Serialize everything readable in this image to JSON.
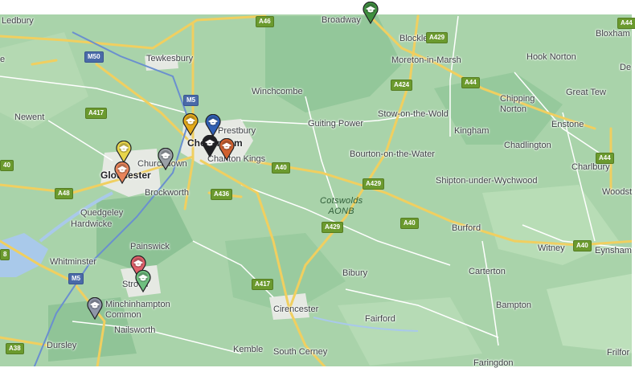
{
  "map": {
    "colors": {
      "land": "#a9d3aa",
      "land_dark": "#8fc496",
      "land_light": "#c4e2c2",
      "urban": "#e8ebe6",
      "water": "#a9c9ea",
      "road_major": "#f3d36b",
      "road_outline": "#d8b54a",
      "road_minor": "#ffffff",
      "top_bar": "#ffffff"
    },
    "places": [
      {
        "name": "Ledbury",
        "size": "normal"
      },
      {
        "name": "Broadway",
        "size": "normal"
      },
      {
        "name": "Blockley",
        "size": "normal"
      },
      {
        "name": "Bloxham",
        "size": "normal"
      },
      {
        "name": "Tewkesbury",
        "size": "normal"
      },
      {
        "name": "Moreton-in-Marsh",
        "size": "normal"
      },
      {
        "name": "Hook Norton",
        "size": "normal"
      },
      {
        "name": "De",
        "size": "normal"
      },
      {
        "name": "e",
        "size": "normal"
      },
      {
        "name": "Winchcombe",
        "size": "normal"
      },
      {
        "name": "Great Tew",
        "size": "normal"
      },
      {
        "name": "Newent",
        "size": "normal"
      },
      {
        "name": "Chipping\nNorton",
        "size": "normal"
      },
      {
        "name": "Prestbury",
        "size": "normal"
      },
      {
        "name": "Guiting Power",
        "size": "normal"
      },
      {
        "name": "Stow-on-the-Wold",
        "size": "normal"
      },
      {
        "name": "Enstone",
        "size": "normal"
      },
      {
        "name": "Kingham",
        "size": "normal"
      },
      {
        "name": "Cheltenham",
        "size": "big"
      },
      {
        "name": "Chadlington",
        "size": "normal"
      },
      {
        "name": "Charlton Kings",
        "size": "normal"
      },
      {
        "name": "Churchdown",
        "size": "normal"
      },
      {
        "name": "Bourton-on-the-Water",
        "size": "normal"
      },
      {
        "name": "Charlbury",
        "size": "normal"
      },
      {
        "name": "Gloucester",
        "size": "big"
      },
      {
        "name": "Shipton-under-Wychwood",
        "size": "normal"
      },
      {
        "name": "Woodst",
        "size": "normal"
      },
      {
        "name": "Brockworth",
        "size": "normal"
      },
      {
        "name": "Quedgeley",
        "size": "normal"
      },
      {
        "name": "Hardwicke",
        "size": "normal"
      },
      {
        "name": "Burford",
        "size": "normal"
      },
      {
        "name": "Painswick",
        "size": "normal"
      },
      {
        "name": "Witney",
        "size": "normal"
      },
      {
        "name": "Eynsham",
        "size": "normal"
      },
      {
        "name": "Whitminster",
        "size": "normal"
      },
      {
        "name": "Carterton",
        "size": "normal"
      },
      {
        "name": "Bibury",
        "size": "normal"
      },
      {
        "name": "Stroud",
        "size": "normal"
      },
      {
        "name": "Minchinhampton\nCommon",
        "size": "normal"
      },
      {
        "name": "Bampton",
        "size": "normal"
      },
      {
        "name": "Cirencester",
        "size": "normal"
      },
      {
        "name": "Fairford",
        "size": "normal"
      },
      {
        "name": "Nailsworth",
        "size": "normal"
      },
      {
        "name": "Kemble",
        "size": "normal"
      },
      {
        "name": "South Cerney",
        "size": "normal"
      },
      {
        "name": "Dursley",
        "size": "normal"
      },
      {
        "name": "Faringdon",
        "size": "normal"
      },
      {
        "name": "Frilfor",
        "size": "normal"
      }
    ],
    "aonb_label": "Cotswolds\nAONB",
    "road_shields": [
      {
        "label": "A46",
        "kind": "a"
      },
      {
        "label": "A429",
        "kind": "a"
      },
      {
        "label": "A44",
        "kind": "a"
      },
      {
        "label": "M50",
        "kind": "m"
      },
      {
        "label": "A424",
        "kind": "a"
      },
      {
        "label": "A44",
        "kind": "a"
      },
      {
        "label": "M5",
        "kind": "m"
      },
      {
        "label": "A417",
        "kind": "a"
      },
      {
        "label": "A40",
        "kind": "a"
      },
      {
        "label": "A44",
        "kind": "a"
      },
      {
        "label": "40",
        "kind": "a"
      },
      {
        "label": "A429",
        "kind": "a"
      },
      {
        "label": "A48",
        "kind": "a"
      },
      {
        "label": "A436",
        "kind": "a"
      },
      {
        "label": "A40",
        "kind": "a"
      },
      {
        "label": "A429",
        "kind": "a"
      },
      {
        "label": "A40",
        "kind": "a"
      },
      {
        "label": "8",
        "kind": "a"
      },
      {
        "label": "M5",
        "kind": "m"
      },
      {
        "label": "A417",
        "kind": "a"
      },
      {
        "label": "A38",
        "kind": "a"
      }
    ],
    "pins": [
      {
        "name": "broadway-pin",
        "color": "#3f8f3f"
      },
      {
        "name": "cheltenham-gold-pin",
        "color": "#e3a91a"
      },
      {
        "name": "prestbury-blue-pin",
        "color": "#2f5fb5"
      },
      {
        "name": "cheltenham-black-pin",
        "color": "#202124"
      },
      {
        "name": "charlton-kings-orange-pin",
        "color": "#d0602e"
      },
      {
        "name": "gloucester-yellow-pin",
        "color": "#e8d54a"
      },
      {
        "name": "churchdown-grey-pin",
        "color": "#9aa0a6"
      },
      {
        "name": "gloucester-salmon-pin",
        "color": "#e8845a"
      },
      {
        "name": "painswick-red-pin",
        "color": "#e0606a"
      },
      {
        "name": "stroud-green-pin",
        "color": "#6fbf7f"
      },
      {
        "name": "minchinhampton-grey-pin",
        "color": "#8f96a8"
      }
    ]
  }
}
